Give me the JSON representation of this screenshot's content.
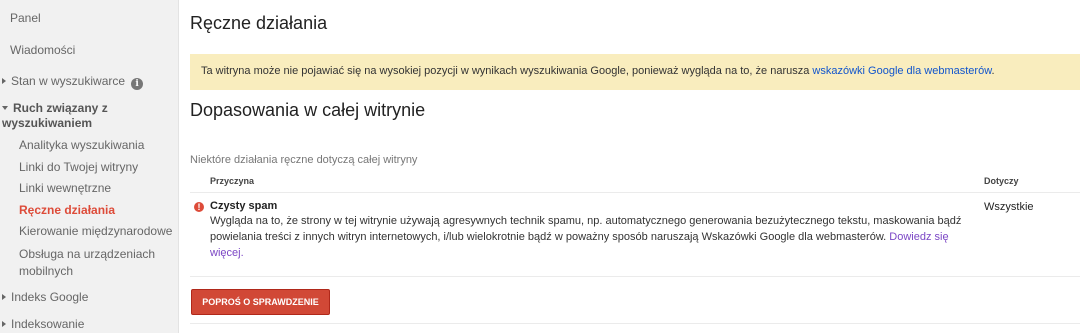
{
  "sidebar": {
    "items": [
      {
        "label": "Panel"
      },
      {
        "label": "Wiadomości"
      },
      {
        "label": "Stan w wyszukiwarce"
      },
      {
        "label": "Ruch związany z wyszukiwaniem"
      },
      {
        "label": "Analityka wyszukiwania"
      },
      {
        "label": "Linki do Twojej witryny"
      },
      {
        "label": "Linki wewnętrzne"
      },
      {
        "label": "Ręczne działania"
      },
      {
        "label": "Kierowanie międzynarodowe"
      },
      {
        "label": "Obsługa na urządzeniach mobilnych"
      },
      {
        "label": "Indeks Google"
      },
      {
        "label": "Indeksowanie"
      }
    ],
    "info_icon": "i"
  },
  "main": {
    "title": "Ręczne działania",
    "banner": {
      "text": "Ta witryna może nie pojawiać się na wysokiej pozycji w wynikach wyszukiwania Google, ponieważ wygląda na to, że narusza ",
      "link": "wskazówki Google dla webmasterów",
      "suffix": "."
    },
    "section_title": "Dopasowania w całej witrynie",
    "subtitle": "Niektóre działania ręczne dotyczą całej witryny",
    "table": {
      "headers": {
        "reason": "Przyczyna",
        "applies": "Dotyczy"
      },
      "rows": [
        {
          "title": "Czysty spam",
          "description": "Wygląda na to, że strony w tej witrynie używają agresywnych technik spamu, np. automatycznego generowania bezużytecznego tekstu, maskowania bądź powielania treści z innych witryn internetowych, i/lub wielokrotnie bądź w poważny sposób naruszają Wskazówki Google dla webmasterów. ",
          "link": "Dowiedz się więcej.",
          "applies": "Wszystkie"
        }
      ]
    },
    "button_label": "POPROŚ O SPRAWDZENIE"
  },
  "colors": {
    "accent_red": "#dd4b39",
    "button_red": "#d14836",
    "banner_yellow": "#f9edbe",
    "link_blue": "#1155cc",
    "link_purple": "#7b46c5"
  },
  "icons": [
    "info-icon",
    "error-icon",
    "caret-right-icon",
    "caret-down-icon"
  ]
}
